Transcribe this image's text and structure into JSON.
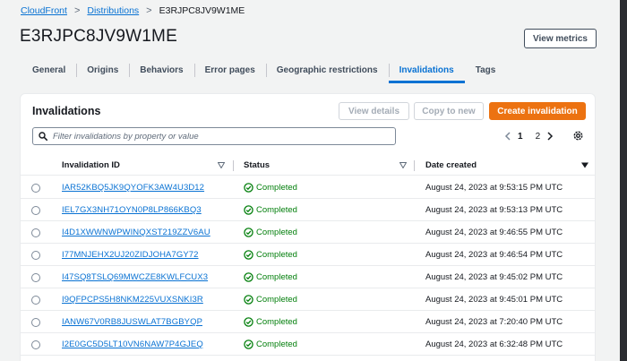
{
  "breadcrumb": {
    "items": [
      {
        "label": "CloudFront",
        "link": true
      },
      {
        "label": "Distributions",
        "link": true
      },
      {
        "label": "E3RJPC8JV9W1ME",
        "link": false
      }
    ],
    "separator": ">"
  },
  "page": {
    "title": "E3RJPC8JV9W1ME",
    "view_metrics_label": "View metrics"
  },
  "tabs": [
    {
      "label": "General"
    },
    {
      "label": "Origins"
    },
    {
      "label": "Behaviors"
    },
    {
      "label": "Error pages"
    },
    {
      "label": "Geographic restrictions"
    },
    {
      "label": "Invalidations",
      "active": true
    },
    {
      "label": "Tags"
    }
  ],
  "invalidations": {
    "title": "Invalidations",
    "view_details_label": "View details",
    "copy_to_new_label": "Copy to new",
    "create_label": "Create invalidation",
    "filter_placeholder": "Filter invalidations by property or value",
    "pagination": {
      "pages": [
        "1",
        "2"
      ],
      "current": "1"
    },
    "columns": {
      "id": "Invalidation ID",
      "status": "Status",
      "date": "Date created"
    },
    "rows": [
      {
        "id": "IAR52KBQ5JK9QYOFK3AW4U3D12",
        "status": "Completed",
        "date": "August 24, 2023 at 9:53:15 PM UTC"
      },
      {
        "id": "IEL7GX3NH71OYN0P8LP866KBQ3",
        "status": "Completed",
        "date": "August 24, 2023 at 9:53:13 PM UTC"
      },
      {
        "id": "I4D1XWWNWPWINQXST219ZZV6AU",
        "status": "Completed",
        "date": "August 24, 2023 at 9:46:55 PM UTC"
      },
      {
        "id": "I77MNJEHX2UJ20ZIDJOHA7GY72",
        "status": "Completed",
        "date": "August 24, 2023 at 9:46:54 PM UTC"
      },
      {
        "id": "I47SQ8TSLQ69MWCZE8KWLFCUX3",
        "status": "Completed",
        "date": "August 24, 2023 at 9:45:02 PM UTC"
      },
      {
        "id": "I9QFPCPS5H8NKM225VUXSNKI3R",
        "status": "Completed",
        "date": "August 24, 2023 at 9:45:01 PM UTC"
      },
      {
        "id": "IANW67V0RB8JUSWLAT7BGBYQP",
        "status": "Completed",
        "date": "August 24, 2023 at 7:20:40 PM UTC"
      },
      {
        "id": "I2E0GC5D5LT10VN6NAW7P4GJEQ",
        "status": "Completed",
        "date": "August 24, 2023 at 6:32:48 PM UTC"
      }
    ]
  },
  "colors": {
    "link": "#0972d3",
    "primary": "#ec7211",
    "success": "#037f0c"
  }
}
